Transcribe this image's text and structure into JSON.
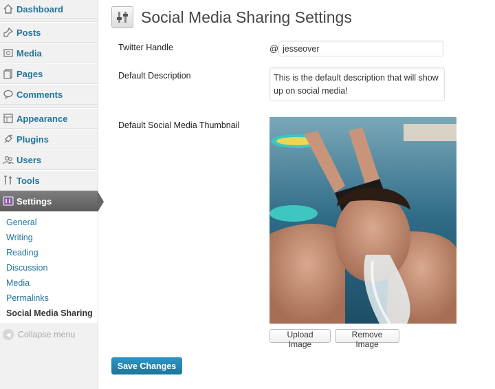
{
  "sidebar": {
    "items": [
      {
        "label": "Dashboard",
        "icon": "dashboard-icon"
      },
      {
        "label": "Posts",
        "icon": "pushpin-icon"
      },
      {
        "label": "Media",
        "icon": "media-icon"
      },
      {
        "label": "Pages",
        "icon": "pages-icon"
      },
      {
        "label": "Comments",
        "icon": "comment-icon"
      },
      {
        "label": "Appearance",
        "icon": "appearance-icon"
      },
      {
        "label": "Plugins",
        "icon": "plug-icon"
      },
      {
        "label": "Users",
        "icon": "users-icon"
      },
      {
        "label": "Tools",
        "icon": "tools-icon"
      },
      {
        "label": "Settings",
        "icon": "settings-icon"
      }
    ],
    "submenu": [
      "General",
      "Writing",
      "Reading",
      "Discussion",
      "Media",
      "Permalinks",
      "Social Media Sharing"
    ],
    "collapse_label": "Collapse menu"
  },
  "page": {
    "title": "Social Media Sharing Settings",
    "twitter_label": "Twitter Handle",
    "at_sign": "@",
    "twitter_value": "jesseover",
    "description_label": "Default Description",
    "description_value": "This is the default description that will show up on social media!",
    "thumbnail_label": "Default Social Media Thumbnail",
    "upload_label": "Upload Image",
    "remove_label": "Remove Image",
    "save_label": "Save Changes"
  },
  "colors": {
    "link": "#21759b",
    "active_menu": "#6d6d6d",
    "primary_button": "#21759b"
  }
}
